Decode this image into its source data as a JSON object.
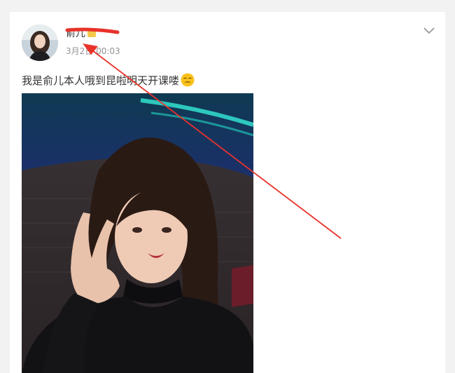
{
  "post": {
    "username": "俞儿",
    "timestamp": "3月2日 00:03",
    "text": "我是俞儿本人哦到昆啦明天开课喽",
    "emoji": "smirk-emoji"
  },
  "icons": {
    "expand": "chevron-down-icon"
  },
  "annotation": {
    "color": "#e8322a"
  }
}
